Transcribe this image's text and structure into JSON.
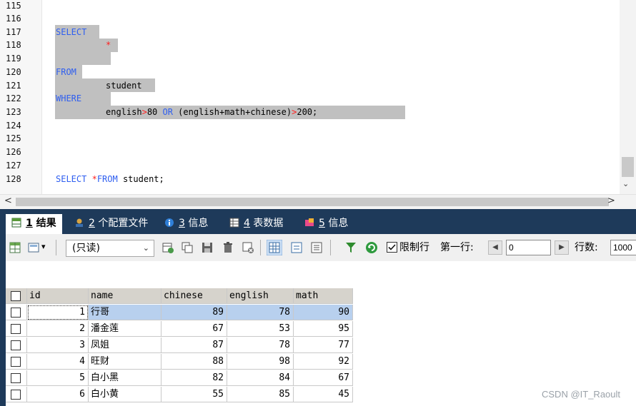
{
  "editor": {
    "lines": [
      {
        "num": "115",
        "text": ""
      },
      {
        "num": "116",
        "text": ""
      },
      {
        "num": "117",
        "text": "SELECT"
      },
      {
        "num": "118",
        "text": "*"
      },
      {
        "num": "119",
        "text": ""
      },
      {
        "num": "120",
        "text": "FROM"
      },
      {
        "num": "121",
        "text": "student"
      },
      {
        "num": "122",
        "text": "WHERE"
      },
      {
        "num": "123",
        "text": "english>80 OR (english+math+chinese)>200;"
      },
      {
        "num": "124",
        "text": ""
      },
      {
        "num": "125",
        "text": ""
      },
      {
        "num": "126",
        "text": ""
      },
      {
        "num": "127",
        "text": ""
      },
      {
        "num": "128",
        "text": "SELECT *FROM student;"
      }
    ],
    "tokens": {
      "select": "SELECT",
      "star": "*",
      "from": "FROM",
      "table": "student",
      "where": "WHERE",
      "cond_a": "english",
      "cond_gt": ">",
      "cond_80": "80 ",
      "cond_or": "OR",
      "cond_b": " (english+math+chinese)",
      "cond_gt2": ">",
      "cond_200": "200;",
      "l128_select": "SELECT ",
      "l128_star": "*",
      "l128_from": "FROM",
      "l128_rest": " student;"
    }
  },
  "tabs": [
    {
      "num": "1",
      "label": " 结果"
    },
    {
      "num": "2",
      "label": " 个配置文件"
    },
    {
      "num": "3",
      "label": " 信息"
    },
    {
      "num": "4",
      "label": " 表数据"
    },
    {
      "num": "5",
      "label": " 信息"
    }
  ],
  "toolbar": {
    "mode_value": "(只读)",
    "limit_label": "限制行",
    "first_row_label": "第一行:",
    "first_row_value": "0",
    "row_count_label": "行数:",
    "row_count_value": "1000"
  },
  "grid": {
    "columns": [
      "id",
      "name",
      "chinese",
      "english",
      "math"
    ],
    "rows": [
      {
        "id": "1",
        "name": "行哥",
        "chinese": "89",
        "english": "78",
        "math": "90"
      },
      {
        "id": "2",
        "name": "潘金莲",
        "chinese": "67",
        "english": "53",
        "math": "95"
      },
      {
        "id": "3",
        "name": "凤姐",
        "chinese": "87",
        "english": "78",
        "math": "77"
      },
      {
        "id": "4",
        "name": "旺财",
        "chinese": "88",
        "english": "98",
        "math": "92"
      },
      {
        "id": "5",
        "name": "白小黑",
        "chinese": "82",
        "english": "84",
        "math": "67"
      },
      {
        "id": "6",
        "name": "白小黄",
        "chinese": "55",
        "english": "85",
        "math": "45"
      }
    ]
  },
  "watermark": "CSDN @IT_Raoult",
  "colors": {
    "keyword": "#2e5ef0",
    "operator": "#ff2020",
    "selection": "#c0c0c0",
    "panel_bg": "#1e3a5a",
    "selected_row": "#b8d0ee"
  }
}
